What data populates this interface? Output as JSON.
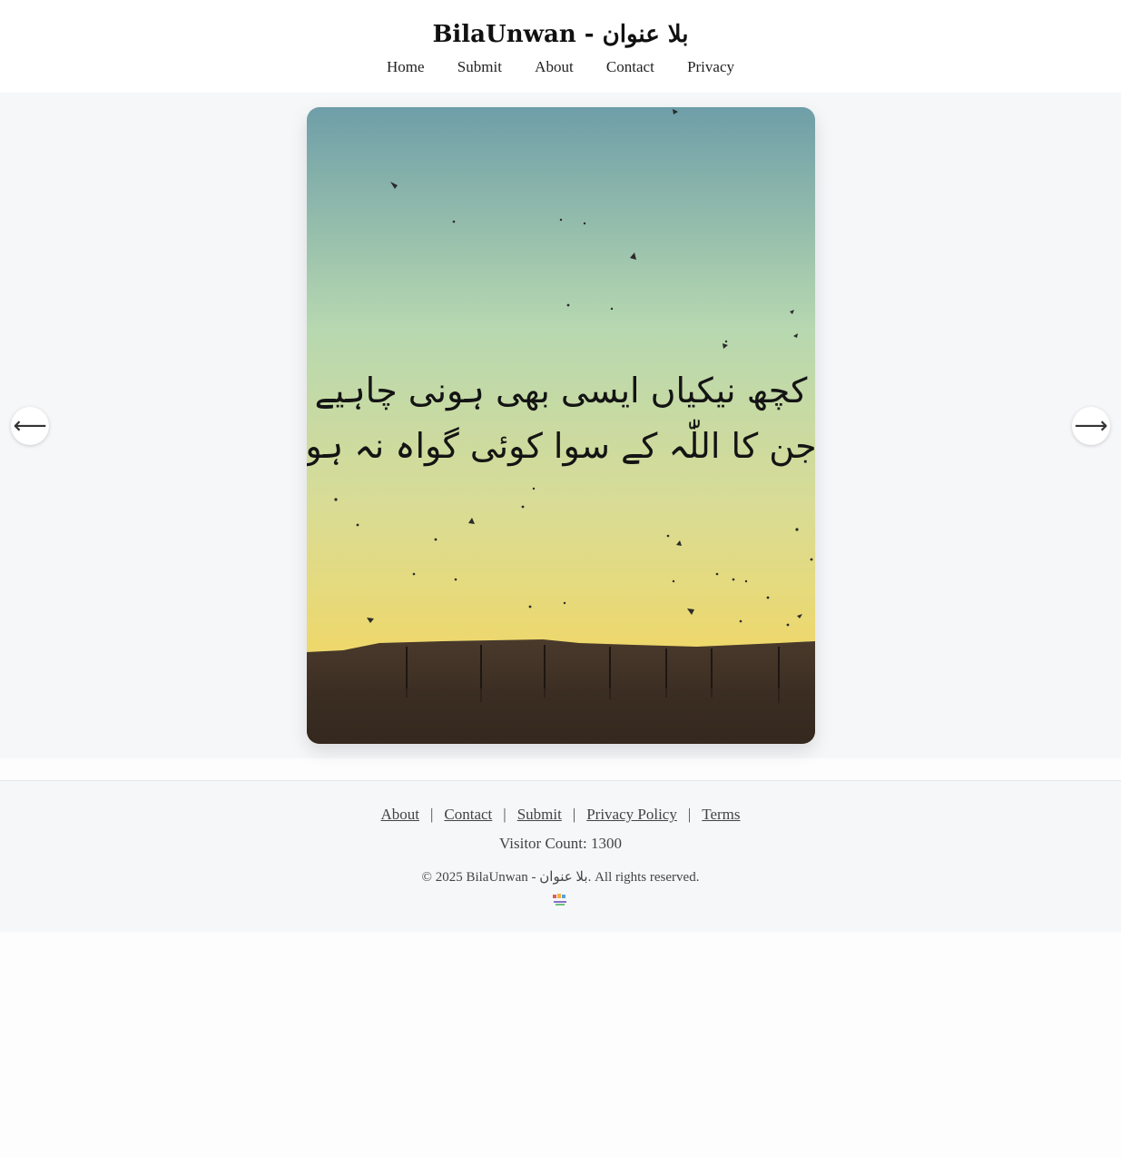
{
  "header": {
    "title": "BilaUnwan - بلا عنوان",
    "nav": [
      "Home",
      "Submit",
      "About",
      "Contact",
      "Privacy"
    ]
  },
  "slideshow": {
    "prev_arrow": "⟵",
    "next_arrow": "⟶",
    "slide_text": [
      "کچھ نیکیاں ایسی بھی ہونی چاہیے",
      "جن کا اللّٰہ کے سوا کوئی گواہ نہ ہو"
    ]
  },
  "footer": {
    "links": [
      "About",
      "Contact",
      "Submit",
      "Privacy Policy",
      "Terms"
    ],
    "separator": "|",
    "visitor_count": "Visitor Count: 1300",
    "copyright": "© 2025 BilaUnwan - بلا عنوان. All rights reserved."
  },
  "colors": {
    "page_background": "#fdfdfd",
    "band_background": "#f6f7f9",
    "sky_top": "#6f9fa8",
    "sky_middle": "#b9d9ae",
    "sky_bottom": "#e9d46a",
    "wall": "#3a2c22"
  },
  "icons": [
    "arrow-left-icon",
    "arrow-right-icon",
    "site-logo-icon"
  ]
}
